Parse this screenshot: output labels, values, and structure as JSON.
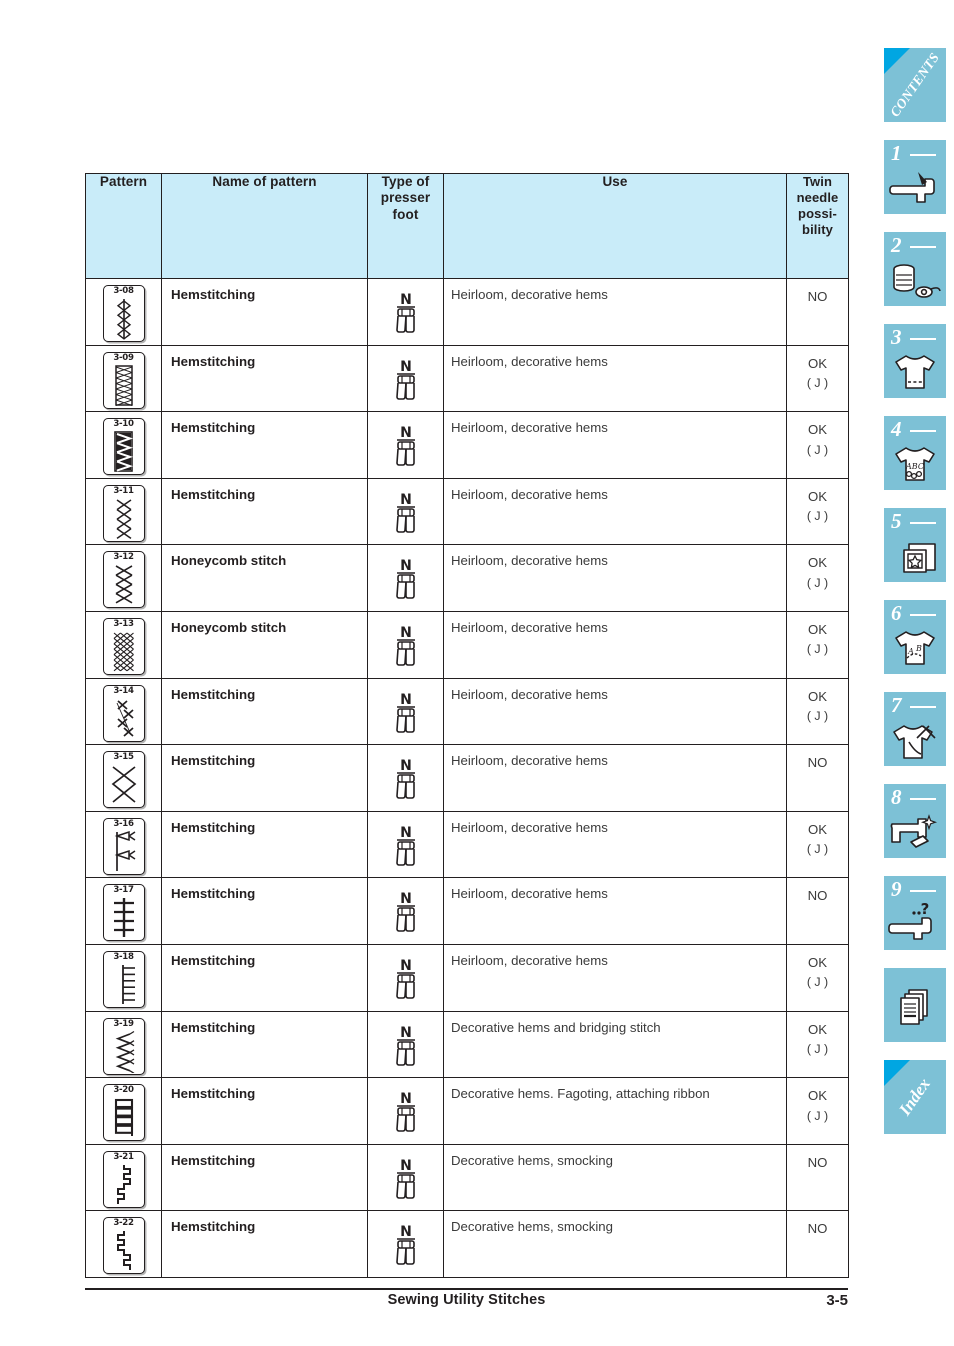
{
  "footer": {
    "title": "Sewing Utility Stitches",
    "page_number": "3-5"
  },
  "colors": {
    "header_fill": "#c9ecf9",
    "tab_fill": "#7dc1d6",
    "tab_corner": "#00a6e2",
    "rule": "#231f20"
  },
  "table": {
    "headers": {
      "pattern": "Pattern",
      "name": "Name of pattern",
      "presser_foot": "Type of\npresser\nfoot",
      "presser_foot_line1": "Type of",
      "presser_foot_line2": "presser",
      "presser_foot_line3": "foot",
      "use": "Use",
      "twin_line1": "Twin",
      "twin_line2": "needle",
      "twin_line3": "possi-",
      "twin_line4": "bility"
    },
    "rows": [
      {
        "pattern_code": "3-08",
        "pattern_art": "vertical-line-with-diamonds",
        "name": "Hemstitching",
        "foot": "N",
        "foot_icon": "presser-foot-n-icon",
        "use": "Heirloom, decorative hems",
        "twin": "NO",
        "twin_sub": ""
      },
      {
        "pattern_code": "3-09",
        "pattern_art": "dense-ladder-cross",
        "name": "Hemstitching",
        "foot": "N",
        "foot_icon": "presser-foot-n-icon",
        "use": "Heirloom, decorative hems",
        "twin": "OK",
        "twin_sub": "( J )"
      },
      {
        "pattern_code": "3-10",
        "pattern_art": "solid-zigzag-band",
        "name": "Hemstitching",
        "foot": "N",
        "foot_icon": "presser-foot-n-icon",
        "use": "Heirloom, decorative hems",
        "twin": "OK",
        "twin_sub": "( J )"
      },
      {
        "pattern_code": "3-11",
        "pattern_art": "open-x-chain",
        "name": "Hemstitching",
        "foot": "N",
        "foot_icon": "presser-foot-n-icon",
        "use": "Heirloom, decorative hems",
        "twin": "OK",
        "twin_sub": "( J )"
      },
      {
        "pattern_code": "3-12",
        "pattern_art": "double-diamond-chain",
        "name": "Honeycomb stitch",
        "foot": "N",
        "foot_icon": "presser-foot-n-icon",
        "use": "Heirloom, decorative hems",
        "twin": "OK",
        "twin_sub": "( J )"
      },
      {
        "pattern_code": "3-13",
        "pattern_art": "honeycomb-mesh",
        "name": "Honeycomb stitch",
        "foot": "N",
        "foot_icon": "presser-foot-n-icon",
        "use": "Heirloom, decorative hems",
        "twin": "OK",
        "twin_sub": "( J )"
      },
      {
        "pattern_code": "3-14",
        "pattern_art": "offset-x-stitches",
        "name": "Hemstitching",
        "foot": "N",
        "foot_icon": "presser-foot-n-icon",
        "use": "Heirloom, decorative hems",
        "twin": "OK",
        "twin_sub": "( J )"
      },
      {
        "pattern_code": "3-15",
        "pattern_art": "large-x-cross",
        "name": "Hemstitching",
        "foot": "N",
        "foot_icon": "presser-foot-n-icon",
        "use": "Heirloom, decorative hems",
        "twin": "NO",
        "twin_sub": ""
      },
      {
        "pattern_code": "3-16",
        "pattern_art": "bowtie-pair",
        "name": "Hemstitching",
        "foot": "N",
        "foot_icon": "presser-foot-n-icon",
        "use": "Heirloom, decorative hems",
        "twin": "OK",
        "twin_sub": "( J )"
      },
      {
        "pattern_code": "3-17",
        "pattern_art": "double-bar-ladder",
        "name": "Hemstitching",
        "foot": "N",
        "foot_icon": "presser-foot-n-icon",
        "use": "Heirloom, decorative hems",
        "twin": "NO",
        "twin_sub": ""
      },
      {
        "pattern_code": "3-18",
        "pattern_art": "comb-ladder",
        "name": "Hemstitching",
        "foot": "N",
        "foot_icon": "presser-foot-n-icon",
        "use": "Heirloom, decorative hems",
        "twin": "OK",
        "twin_sub": "( J )"
      },
      {
        "pattern_code": "3-19",
        "pattern_art": "feather-stitch",
        "name": "Hemstitching",
        "foot": "N",
        "foot_icon": "presser-foot-n-icon",
        "use": "Decorative hems and bridging stitch",
        "twin": "OK",
        "twin_sub": "( J )"
      },
      {
        "pattern_code": "3-20",
        "pattern_art": "box-ladder",
        "name": "Hemstitching",
        "foot": "N",
        "foot_icon": "presser-foot-n-icon",
        "use": "Decorative hems. Fagoting, attaching ribbon",
        "twin": "OK",
        "twin_sub": "( J )"
      },
      {
        "pattern_code": "3-21",
        "pattern_art": "stair-step-right",
        "name": "Hemstitching",
        "foot": "N",
        "foot_icon": "presser-foot-n-icon",
        "use": "Decorative hems, smocking",
        "twin": "NO",
        "twin_sub": ""
      },
      {
        "pattern_code": "3-22",
        "pattern_art": "stair-step-left",
        "name": "Hemstitching",
        "foot": "N",
        "foot_icon": "presser-foot-n-icon",
        "use": "Decorative hems, smocking",
        "twin": "NO",
        "twin_sub": ""
      }
    ]
  },
  "sidebar": {
    "tabs": [
      {
        "kind": "word",
        "label": "CONTENTS",
        "icon": "contents-tab"
      },
      {
        "kind": "number",
        "label": "1",
        "icon": "sewing-machine-icon"
      },
      {
        "kind": "number",
        "label": "2",
        "icon": "thread-spool-icon"
      },
      {
        "kind": "number",
        "label": "3",
        "icon": "tshirt-stitch-icon"
      },
      {
        "kind": "number",
        "label": "4",
        "icon": "tshirt-abc-icon"
      },
      {
        "kind": "number",
        "label": "5",
        "icon": "embroidery-hoop-icon"
      },
      {
        "kind": "number",
        "label": "6",
        "icon": "tshirt-monogram-icon"
      },
      {
        "kind": "number",
        "label": "7",
        "icon": "tshirt-scissors-icon"
      },
      {
        "kind": "number",
        "label": "8",
        "icon": "machine-cleaning-icon"
      },
      {
        "kind": "number",
        "label": "9",
        "icon": "machine-question-icon"
      },
      {
        "kind": "icon-only",
        "label": "",
        "icon": "documents-icon"
      },
      {
        "kind": "word",
        "label": "Index",
        "icon": "index-tab"
      }
    ]
  }
}
